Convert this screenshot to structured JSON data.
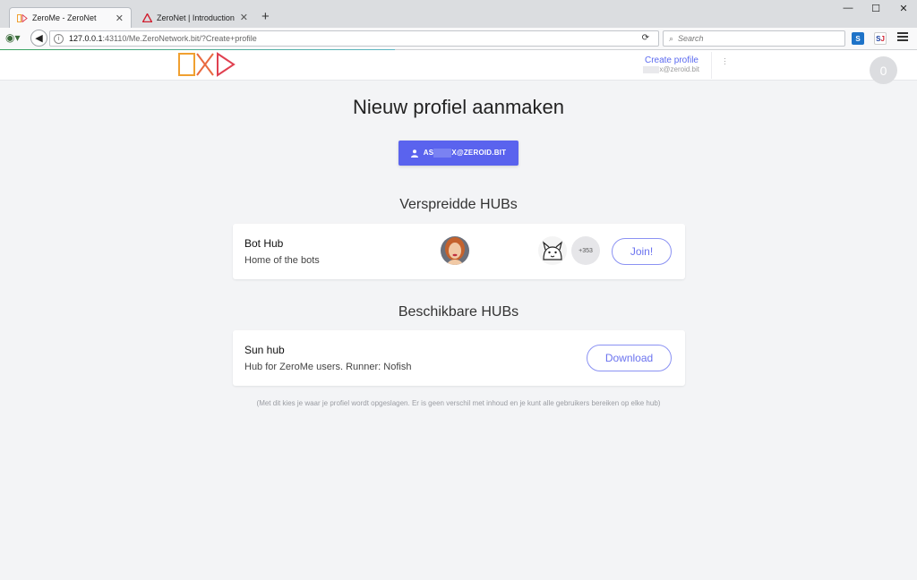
{
  "browser": {
    "tabs": [
      {
        "title": "ZeroMe - ZeroNet",
        "active": true,
        "icon": "zerome-favicon"
      },
      {
        "title": "ZeroNet | Introduction & ...",
        "active": false,
        "icon": "zeronet-favicon"
      }
    ],
    "new_tab": "+",
    "url": {
      "host": "127.0.0.1",
      "path": ":43110/Me.ZeroNetwork.bit/?Create+profile"
    },
    "search_placeholder": "Search",
    "window_controls": {
      "minimize": "—",
      "maximize": "☐",
      "close": "✕"
    }
  },
  "header": {
    "create_profile": "Create profile",
    "user_address": "x@zeroid.bit",
    "avatar_count": "0"
  },
  "main": {
    "title": "Nieuw profiel aanmaken",
    "user_button": {
      "prefix": "AS",
      "suffix": "X@ZEROID.BIT"
    },
    "seeded_section": "Verspreidde HUBs",
    "available_section": "Beschikbare HUBs",
    "seeded_hubs": [
      {
        "name": "Bot Hub",
        "description": "Home of the bots",
        "extra_users": "+353",
        "action": "Join!"
      }
    ],
    "available_hubs": [
      {
        "name": "Sun hub",
        "description": "Hub for ZeroMe users. Runner: Nofish",
        "action": "Download"
      }
    ],
    "footnote": "(Met dit kies je waar je profiel wordt opgeslagen. Er is geen verschil met inhoud en je kunt alle gebruikers bereiken op elke hub)"
  },
  "colors": {
    "accent": "#5a63ee",
    "link": "#5b6af0",
    "background": "#f3f4f6"
  }
}
